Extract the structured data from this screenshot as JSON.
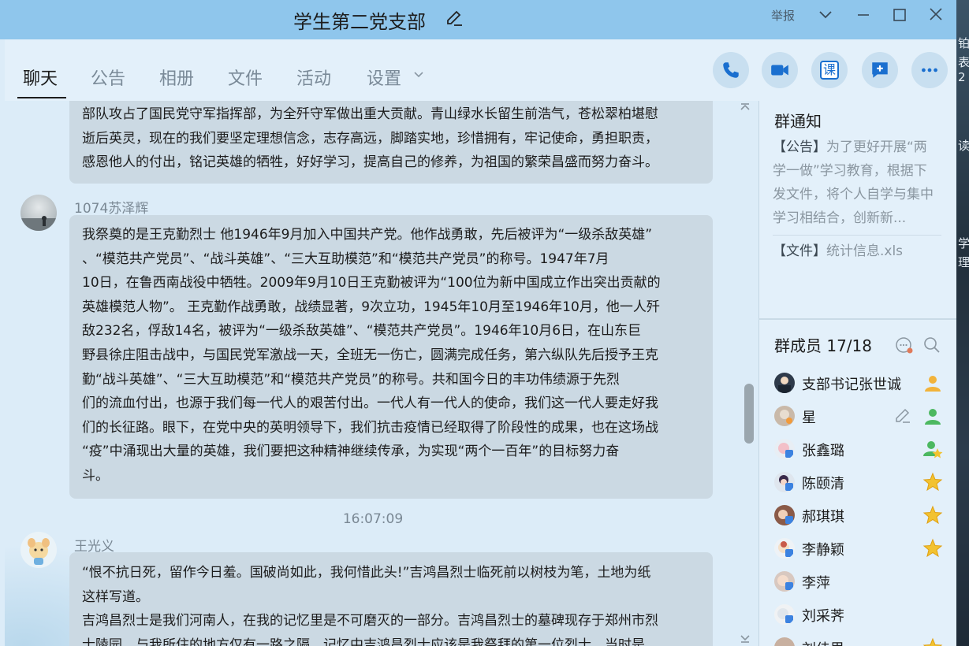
{
  "window": {
    "title": "学生第二党支部",
    "report_label": "举报"
  },
  "tabs": [
    {
      "label": "聊天",
      "active": true
    },
    {
      "label": "公告",
      "active": false
    },
    {
      "label": "相册",
      "active": false
    },
    {
      "label": "文件",
      "active": false
    },
    {
      "label": "活动",
      "active": false
    },
    {
      "label": "设置",
      "active": false
    }
  ],
  "actions": {
    "course_label": "课"
  },
  "chat": {
    "messages": [
      {
        "lines": [
          "部队攻占了国民党守军指挥部，为全歼守军做出重大贡献。青山绿水长留生前浩气，苍松翠柏堪慰",
          "逝后英灵，现在的我们要坚定理想信念，志存高远，脚踏实地，珍惜拥有，牢记使命，勇担职责，",
          "感恩他人的付出，铭记英雄的牺牲，好好学习，提高自己的修养，为祖国的繁荣昌盛而努力奋斗。"
        ]
      },
      {
        "sender": "1074苏泽辉",
        "lines": [
          "我祭奠的是王克勤烈士 他1946年9月加入中国共产党。他作战勇敢，先后被评为“一级杀敌英雄”",
          "、“模范共产党员”、“战斗英雄”、“三大互助模范”和“模范共产党员”的称号。1947年7月",
          "10日，在鲁西南战役中牺牲。2009年9月10日王克勤被评为“100位为新中国成立作出突出贡献的",
          "英雄模范人物”。 王克勤作战勇敢，战绩显著，9次立功，1945年10月至1946年10月，他一人歼",
          "敌232名，俘敌14名，被评为“一级杀敌英雄”、“模范共产党员”。1946年10月6日，在山东巨",
          "野县徐庄阻击战中，与国民党军激战一天，全班无一伤亡，圆满完成任务，第六纵队先后授予王克",
          "勤“战斗英雄”、“三大互助模范”和“模范共产党员”的称号。共和国今日的丰功伟绩源于先烈",
          "们的流血付出，也源于我们每一代人的艰苦付出。一代人有一代人的使命，我们这一代人要走好我",
          "们的长征路。眼下，在党中央的英明领导下，我们抗击疫情已经取得了阶段性的成果，也在这场战",
          "“疫”中涌现出大量的英雄，我们要把这种精神继续传承，为实现“两个一百年”的目标努力奋",
          "斗。"
        ]
      },
      {
        "timestamp": "16:07:09",
        "sender": "王光义",
        "lines": [
          "“恨不抗日死，留作今日羞。国破尚如此，我何惜此头!”吉鸿昌烈士临死前以树枝为笔，土地为纸",
          "这样写道。",
          "吉鸿昌烈士是我们河南人，在我的记忆里是不可磨灭的一部分。吉鸿昌烈士的墓碑现存于郑州市烈",
          "士陵园，与我所住的地方仅有一路之隔。记忆中吉鸿昌烈士应该是我祭拜的第一位烈士，当时是"
        ]
      }
    ]
  },
  "notice": {
    "title": "群通知",
    "announcement_tag": "【公告】",
    "announcement_text": "为了更好开展“两学一做”学习教育，根据下发文件，将个人自学与集中学习相结合，创新新...",
    "file_tag": "【文件】",
    "file_name": "统计信息.xls"
  },
  "members": {
    "title": "群成员 17/18",
    "list": [
      {
        "name": "支部书记张世诚",
        "badge": "owner"
      },
      {
        "name": "星",
        "badge": "admin",
        "editable": true
      },
      {
        "name": "张鑫璐",
        "badge": "admin-star"
      },
      {
        "name": "陈颐清",
        "badge": "star"
      },
      {
        "name": "郝琪琪",
        "badge": "star"
      },
      {
        "name": "李静颖",
        "badge": "star"
      },
      {
        "name": "李萍",
        "badge": ""
      },
      {
        "name": "刘采荠",
        "badge": ""
      },
      {
        "name": "刘佳思",
        "badge": "star"
      }
    ]
  },
  "desktop_strip_text": [
    "铂",
    "表2",
    "读",
    "学",
    "理"
  ]
}
